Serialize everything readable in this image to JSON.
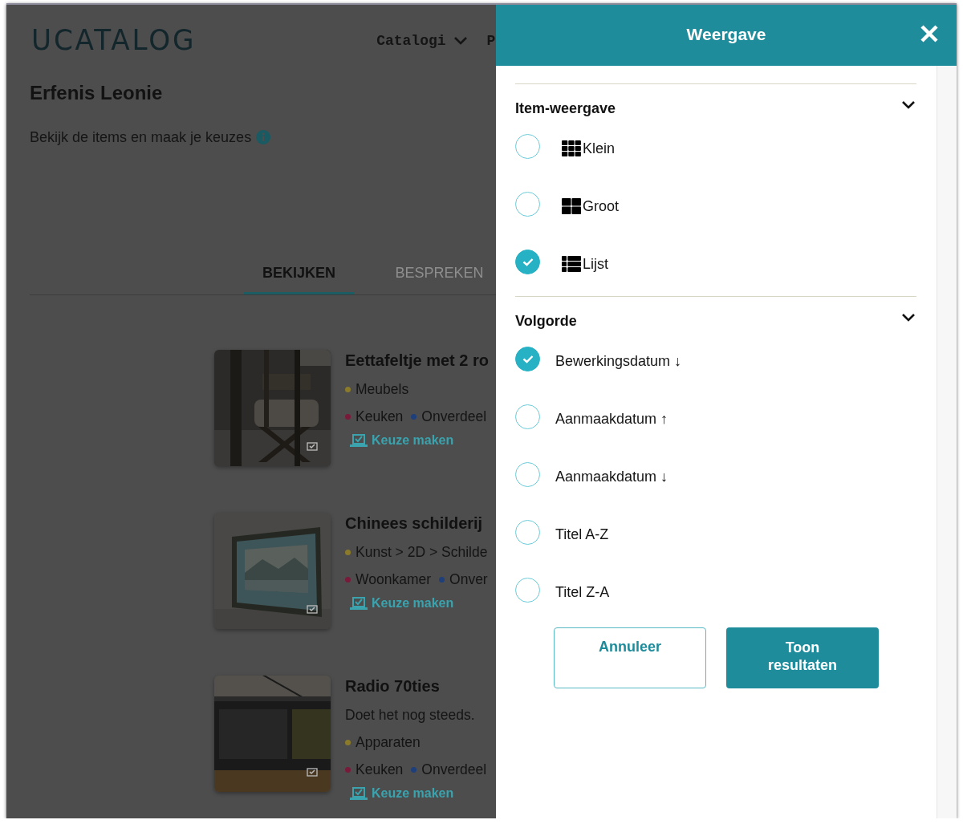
{
  "header": {
    "logo": "UCATALOG",
    "nav": [
      {
        "label": "Catalogi",
        "dropdown": true
      },
      {
        "label": "P",
        "dropdown": false
      }
    ]
  },
  "page": {
    "title": "Erfenis Leonie",
    "subtitle": "Bekijk de items en maak je keuzes"
  },
  "tabs": [
    {
      "label": "BEKIJKEN",
      "selected": true
    },
    {
      "label": "BESPREKEN",
      "selected": false
    }
  ],
  "items": [
    {
      "title": "Eettafeltje met 2 ro",
      "kind": "chair",
      "categories": [
        {
          "label": "Meubels",
          "color": "#8a7a2a"
        }
      ],
      "locations": [
        {
          "label": "Keuken",
          "color": "#7a1a3a"
        },
        {
          "label": "Onverdeel",
          "color": "#1e3f7a"
        }
      ],
      "action": "Keuze maken"
    },
    {
      "title": "Chinees schilderij",
      "kind": "painting",
      "categories": [
        {
          "label": "Kunst > 2D > Schilde",
          "color": "#8a7a2a"
        }
      ],
      "locations": [
        {
          "label": "Woonkamer",
          "color": "#7a1a3a"
        },
        {
          "label": "Onver",
          "color": "#1e3f7a"
        }
      ],
      "action": "Keuze maken"
    },
    {
      "title": "Radio 70ties",
      "kind": "radio",
      "description": "Doet het nog steeds.",
      "categories": [
        {
          "label": "Apparaten",
          "color": "#8a7a2a"
        }
      ],
      "locations": [
        {
          "label": "Keuken",
          "color": "#7a1a3a"
        },
        {
          "label": "Onverdeel",
          "color": "#1e3f7a"
        }
      ],
      "action": "Keuze maken"
    }
  ],
  "panel": {
    "title": "Weergave",
    "sections": [
      {
        "title": "Item-weergave",
        "expanded": true,
        "options": [
          {
            "label": "Klein",
            "kind": "small-grid",
            "selected": false
          },
          {
            "label": "Groot",
            "kind": "large-grid",
            "selected": false
          },
          {
            "label": "Lijst",
            "kind": "list",
            "selected": true
          }
        ]
      },
      {
        "title": "Volgorde",
        "expanded": true,
        "options": [
          {
            "label": "Bewerkingsdatum ↓",
            "selected": true
          },
          {
            "label": "Aanmaakdatum ↑",
            "selected": false
          },
          {
            "label": "Aanmaakdatum ↓",
            "selected": false
          },
          {
            "label": "Titel A-Z",
            "selected": false
          },
          {
            "label": "Titel Z-A",
            "selected": false
          }
        ]
      }
    ],
    "buttons": [
      {
        "label": "Annuleer",
        "kind": "secondary"
      },
      {
        "label": "Toon resultaten",
        "kind": "primary"
      }
    ]
  }
}
